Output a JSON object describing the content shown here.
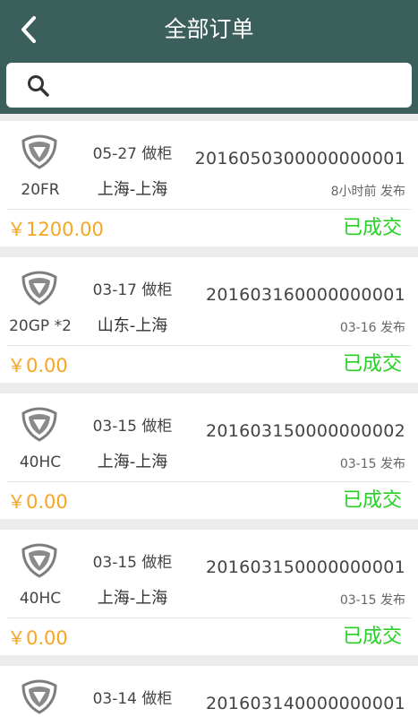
{
  "header": {
    "title": "全部订单",
    "background": "#3b5f5a"
  },
  "search": {
    "placeholder": "",
    "icon": "search-icon"
  },
  "colors": {
    "price": "#f5a623",
    "status": "#27d027",
    "separator_band": "#ececec"
  },
  "orders": [
    {
      "container_type": "20FR",
      "date_action": "05-27 做柜",
      "route": "上海-上海",
      "order_no": "2016050300000000001",
      "published": "8小时前 发布",
      "price": "￥1200.00",
      "status": "已成交"
    },
    {
      "container_type": "20GP *2",
      "date_action": "03-17 做柜",
      "route": "山东-上海",
      "order_no": "201603160000000001",
      "published": "03-16 发布",
      "price": "￥0.00",
      "status": "已成交"
    },
    {
      "container_type": "40HC",
      "date_action": "03-15 做柜",
      "route": "上海-上海",
      "order_no": "201603150000000002",
      "published": "03-15 发布",
      "price": "￥0.00",
      "status": "已成交"
    },
    {
      "container_type": "40HC",
      "date_action": "03-15 做柜",
      "route": "上海-上海",
      "order_no": "201603150000000001",
      "published": "03-15 发布",
      "price": "￥0.00",
      "status": "已成交"
    },
    {
      "container_type": "",
      "date_action": "03-14 做柜",
      "route": "",
      "order_no": "201603140000000001",
      "published": "",
      "price": "",
      "status": ""
    }
  ]
}
